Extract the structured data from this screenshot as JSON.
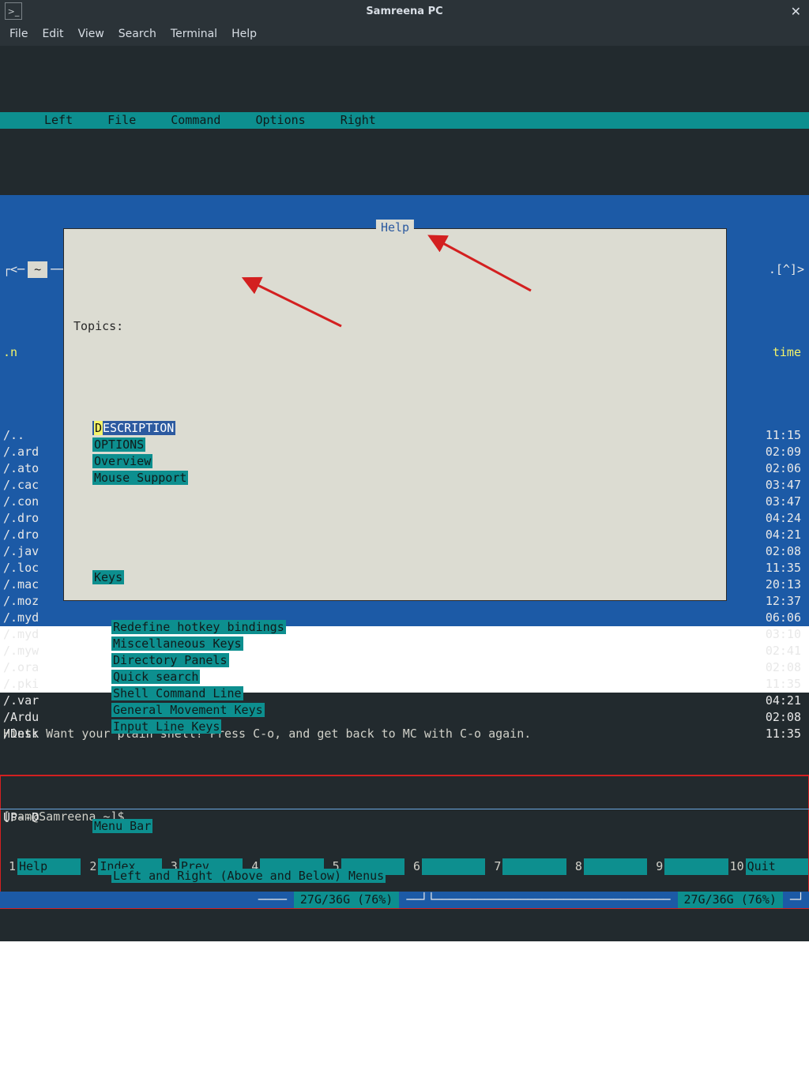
{
  "window": {
    "title": "Samreena PC"
  },
  "menubar": [
    "File",
    "Edit",
    "View",
    "Search",
    "Terminal",
    "Help"
  ],
  "mc_menu": [
    "Left",
    "File",
    "Command",
    "Options",
    "Right"
  ],
  "panel_top": {
    "tilde": "~",
    "mid_label": ".[^]>",
    "left_arrow": "<-",
    "right_label": ".[^]>"
  },
  "left_header": {
    "name": ".n",
    "time": "time"
  },
  "files": [
    {
      "name": "/..",
      "time": "11:15"
    },
    {
      "name": "/.ard",
      "time": "02:09"
    },
    {
      "name": "/.ato",
      "time": "02:06"
    },
    {
      "name": "/.cac",
      "time": "03:47"
    },
    {
      "name": "/.con",
      "time": "03:47"
    },
    {
      "name": "/.dro",
      "time": "04:24"
    },
    {
      "name": "/.dro",
      "time": "04:21"
    },
    {
      "name": "/.jav",
      "time": "02:08"
    },
    {
      "name": "/.loc",
      "time": "11:35"
    },
    {
      "name": "/.mac",
      "time": "20:13"
    },
    {
      "name": "/.moz",
      "time": "12:37"
    },
    {
      "name": "/.myd",
      "time": "06:06"
    },
    {
      "name": "/.myd",
      "time": "03:10"
    },
    {
      "name": "/.myw",
      "time": "02:41"
    },
    {
      "name": "/.ora",
      "time": "02:08"
    },
    {
      "name": "/.pki",
      "time": "11:35"
    },
    {
      "name": "/.var",
      "time": "04:21"
    },
    {
      "name": "/Ardu",
      "time": "02:08"
    },
    {
      "name": "/Desk",
      "time": "11:35"
    }
  ],
  "updir": "UP--D",
  "size_badge": "27G/36G (76%)",
  "help": {
    "title": "Help",
    "header": "Topics:",
    "topics_top": [
      {
        "label": "DESCRIPTION",
        "selected": true,
        "hotkey": "D",
        "rest": "ESCRIPTION"
      },
      {
        "label": "OPTIONS"
      },
      {
        "label": "Overview"
      },
      {
        "label": "Mouse Support"
      }
    ],
    "keys_header": "Keys",
    "keys": [
      "Redefine hotkey bindings",
      "Miscellaneous Keys",
      "Directory Panels",
      "Quick search",
      "Shell Command Line",
      "General Movement Keys",
      "Input Line Keys"
    ],
    "menubar_header": "Menu Bar",
    "menubar_item": "Left and Right (Above and Below) Menus"
  },
  "hint": "Hint: Want your plain shell? Press C-o, and get back to MC with C-o again.",
  "prompt": "[sam@Samreena ~]$ ",
  "fkeys": [
    {
      "n": "1",
      "label": "Help"
    },
    {
      "n": "2",
      "label": "Index"
    },
    {
      "n": "3",
      "label": "Prev"
    },
    {
      "n": "4",
      "label": ""
    },
    {
      "n": "5",
      "label": ""
    },
    {
      "n": "6",
      "label": ""
    },
    {
      "n": "7",
      "label": ""
    },
    {
      "n": "8",
      "label": ""
    },
    {
      "n": "9",
      "label": ""
    },
    {
      "n": "10",
      "label": "Quit"
    }
  ]
}
